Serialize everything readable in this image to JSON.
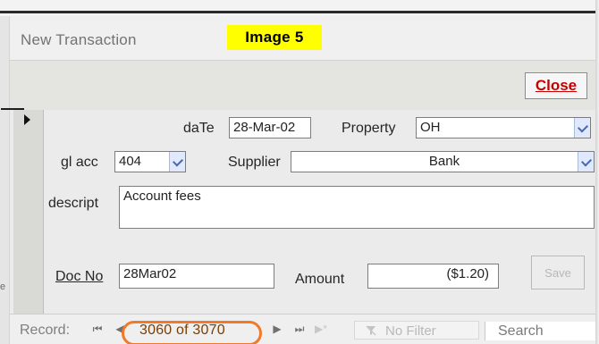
{
  "window": {
    "title": "New Transaction",
    "image_label": "Image 5"
  },
  "toolbar": {
    "close_label": "Close"
  },
  "form": {
    "date_label": "daTe",
    "date_value": "28-Mar-02",
    "property_label": "Property",
    "property_value": "OH",
    "gl_acc_label": "gl acc",
    "gl_acc_value": "404",
    "supplier_label": "Supplier",
    "supplier_value": "Bank",
    "descript_label": "descript",
    "descript_value": "Account fees",
    "doc_no_label": "Doc No",
    "doc_no_value": "28Mar02",
    "amount_label": "Amount",
    "amount_value": "($1.20)",
    "disabled_button_label": "Save"
  },
  "navigation": {
    "record_label": "Record:",
    "record_count": "3060 of 3070",
    "filter_label": "No Filter",
    "search_label": "Search"
  }
}
